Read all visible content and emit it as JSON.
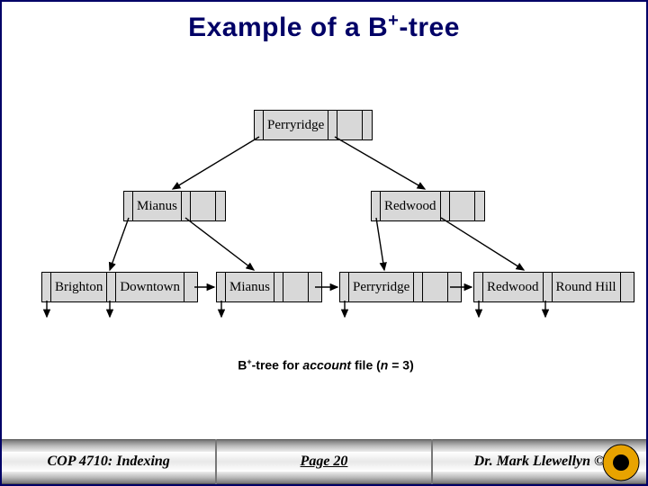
{
  "title_pre": "Example of a B",
  "title_sup": "+",
  "title_post": "-tree",
  "caption_pre": "B",
  "caption_sup": "+",
  "caption_mid": "-tree for ",
  "caption_em": "account",
  "caption_post1": " file (",
  "caption_em2": "n",
  "caption_post2": " = 3)",
  "tree": {
    "root": {
      "k1": "Perryridge",
      "k2": ""
    },
    "internal": [
      {
        "k1": "Mianus",
        "k2": ""
      },
      {
        "k1": "Redwood",
        "k2": ""
      }
    ],
    "leaves": [
      {
        "k1": "Brighton",
        "k2": "Downtown"
      },
      {
        "k1": "Mianus",
        "k2": ""
      },
      {
        "k1": "Perryridge",
        "k2": ""
      },
      {
        "k1": "Redwood",
        "k2": "Round Hill"
      }
    ]
  },
  "footer": {
    "left": "COP 4710: Indexing",
    "center": "Page 20",
    "right": "Dr. Mark Llewellyn ©"
  }
}
